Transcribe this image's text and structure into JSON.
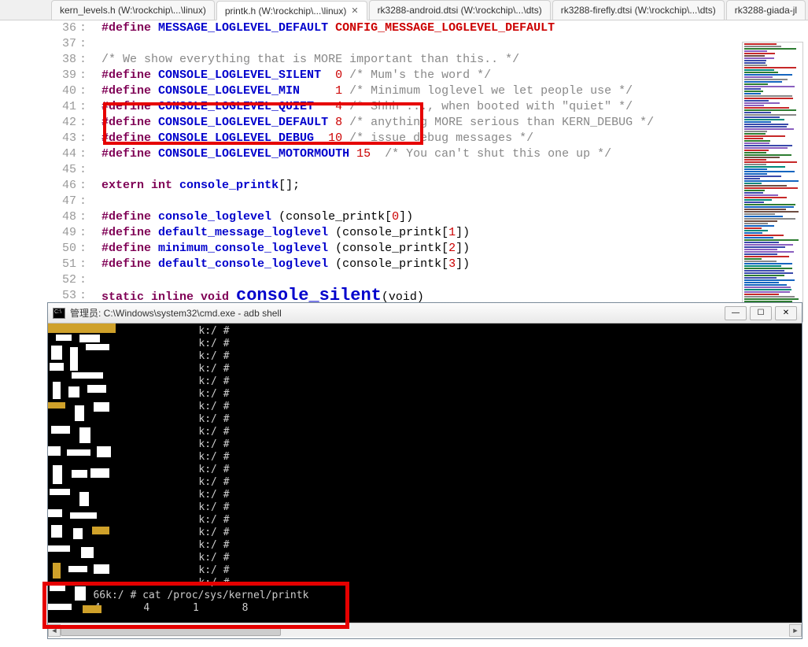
{
  "tabs": [
    {
      "label": "kern_levels.h (W:\\rockchip\\...\\linux)",
      "active": false
    },
    {
      "label": "printk.h (W:\\rockchip\\...\\linux)",
      "active": true
    },
    {
      "label": "rk3288-android.dtsi (W:\\rockchip\\...\\dts)",
      "active": false
    },
    {
      "label": "rk3288-firefly.dtsi (W:\\rockchip\\...\\dts)",
      "active": false
    },
    {
      "label": "rk3288-giada-jl",
      "active": false
    }
  ],
  "code_lines": [
    {
      "n": 36,
      "tokens": [
        [
          "kw",
          "#define "
        ],
        [
          "macro",
          "MESSAGE_LOGLEVEL_DEFAULT "
        ],
        [
          "macro-red",
          "CONFIG_MESSAGE_LOGLEVEL_DEFAULT"
        ]
      ]
    },
    {
      "n": 37,
      "tokens": []
    },
    {
      "n": 38,
      "tokens": [
        [
          "comment",
          "/* We show everything that is MORE important than this.. */"
        ]
      ]
    },
    {
      "n": 39,
      "tokens": [
        [
          "kw",
          "#define "
        ],
        [
          "macro",
          "CONSOLE_LOGLEVEL_SILENT  "
        ],
        [
          "num",
          "0"
        ],
        [
          "comment",
          " /* Mum's the word */"
        ]
      ]
    },
    {
      "n": 40,
      "tokens": [
        [
          "kw",
          "#define "
        ],
        [
          "macro",
          "CONSOLE_LOGLEVEL_MIN     "
        ],
        [
          "num",
          "1"
        ],
        [
          "comment",
          " /* Minimum loglevel we let people use */"
        ]
      ]
    },
    {
      "n": 41,
      "tokens": [
        [
          "kw",
          "#define "
        ],
        [
          "macro",
          "CONSOLE_LOGLEVEL_QUIET   "
        ],
        [
          "num",
          "4"
        ],
        [
          "comment",
          " /* Shhh ..., when booted with \"quiet\" */"
        ]
      ]
    },
    {
      "n": 42,
      "tokens": [
        [
          "kw",
          "#define "
        ],
        [
          "macro",
          "CONSOLE_LOGLEVEL_DEFAULT "
        ],
        [
          "num",
          "8"
        ],
        [
          "comment",
          " /* anything MORE serious than KERN_DEBUG */"
        ]
      ]
    },
    {
      "n": 43,
      "tokens": [
        [
          "kw",
          "#define "
        ],
        [
          "macro",
          "CONSOLE_LOGLEVEL_DEBUG  "
        ],
        [
          "num",
          "10"
        ],
        [
          "comment",
          " /* issue debug messages */"
        ]
      ]
    },
    {
      "n": 44,
      "tokens": [
        [
          "kw",
          "#define "
        ],
        [
          "macro",
          "CONSOLE_LOGLEVEL_MOTORMOUTH "
        ],
        [
          "num",
          "15"
        ],
        [
          "comment",
          "  /* You can't shut this one up */"
        ]
      ]
    },
    {
      "n": 45,
      "tokens": []
    },
    {
      "n": 46,
      "tokens": [
        [
          "kw",
          "extern "
        ],
        [
          "kw",
          "int "
        ],
        [
          "func",
          "console_printk"
        ],
        [
          "ident",
          "[];"
        ]
      ]
    },
    {
      "n": 47,
      "tokens": []
    },
    {
      "n": 48,
      "tokens": [
        [
          "kw",
          "#define "
        ],
        [
          "macro",
          "console_loglevel "
        ],
        [
          "paren",
          "("
        ],
        [
          "ident",
          "console_printk["
        ],
        [
          "bracket-num",
          "0"
        ],
        [
          "ident",
          "])"
        ]
      ]
    },
    {
      "n": 49,
      "tokens": [
        [
          "kw",
          "#define "
        ],
        [
          "macro",
          "default_message_loglevel "
        ],
        [
          "paren",
          "("
        ],
        [
          "ident",
          "console_printk["
        ],
        [
          "bracket-num",
          "1"
        ],
        [
          "ident",
          "])"
        ]
      ]
    },
    {
      "n": 50,
      "tokens": [
        [
          "kw",
          "#define "
        ],
        [
          "macro",
          "minimum_console_loglevel "
        ],
        [
          "paren",
          "("
        ],
        [
          "ident",
          "console_printk["
        ],
        [
          "bracket-num",
          "2"
        ],
        [
          "ident",
          "])"
        ]
      ]
    },
    {
      "n": 51,
      "tokens": [
        [
          "kw",
          "#define "
        ],
        [
          "macro",
          "default_console_loglevel "
        ],
        [
          "paren",
          "("
        ],
        [
          "ident",
          "console_printk["
        ],
        [
          "bracket-num",
          "3"
        ],
        [
          "ident",
          "])"
        ]
      ]
    },
    {
      "n": 52,
      "tokens": []
    }
  ],
  "code_lastline": {
    "n": 53,
    "prefix": "static inline void ",
    "func": "console_silent",
    "suffix": "(void)"
  },
  "terminal": {
    "title": "管理员: C:\\Windows\\system32\\cmd.exe - adb  shell",
    "prompt_lines": [
      "k:/ #",
      "k:/ #",
      "k:/ #",
      "k:/ #",
      "k:/ #",
      "k:/ #",
      "k:/ #",
      "k:/ #",
      "k:/ #",
      "k:/ #",
      "k:/ #",
      "k:/ #",
      "k:/ #",
      "k:/ #",
      "k:/ #",
      "k:/ #",
      "k:/ #",
      "k:/ #",
      "k:/ #",
      "k:/ #",
      "k:/ #"
    ],
    "command_line": "66k:/ # cat /proc/sys/kernel/printk",
    "output_line": "       4       4       1       8"
  }
}
